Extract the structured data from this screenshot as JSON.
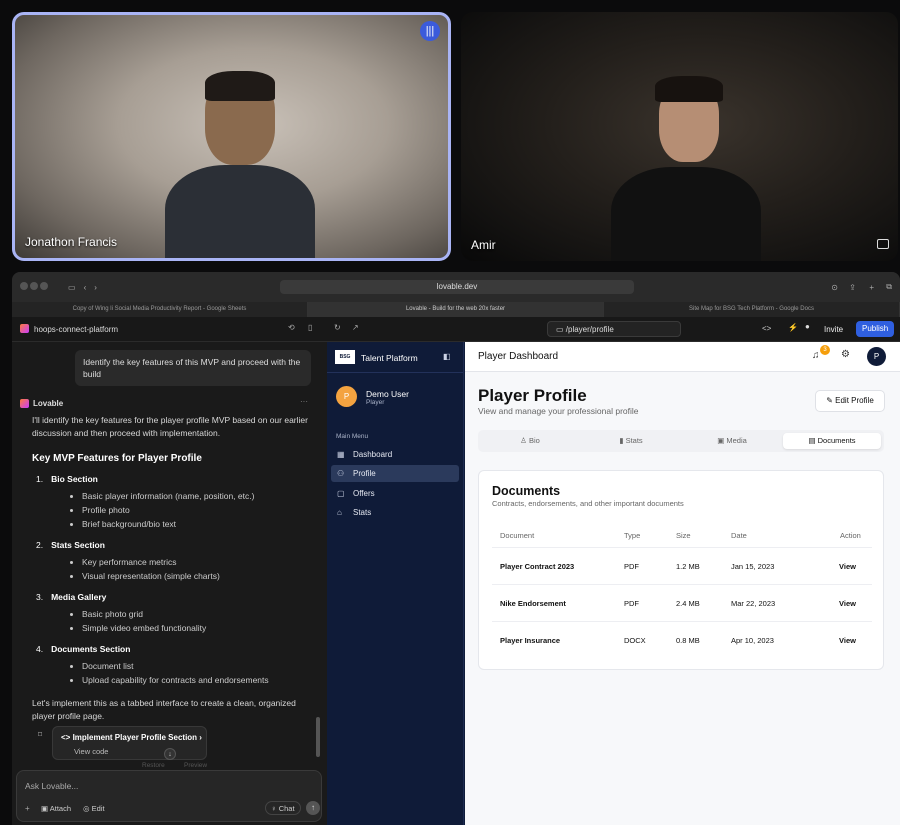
{
  "videos": {
    "left_name": "Jonathon Francis",
    "right_name": "Amir"
  },
  "browser": {
    "url": "lovable.dev",
    "tabs": [
      "Copy of Wing li Social Media Productivity Report - Google Sheets",
      "Lovable - Build for the web 20x faster",
      "Site Map for BSG Tech Platform - Google Docs"
    ]
  },
  "toolbar": {
    "project_name": "hoops-connect-platform",
    "route": "/player/profile",
    "invite": "Invite",
    "publish": "Publish"
  },
  "chat": {
    "user_message": "Identify the key features of this MVP and proceed with the build",
    "assistant_name": "Lovable",
    "intro": "I'll identify the key features for the player profile MVP based on our earlier discussion and then proceed with implementation.",
    "heading": "Key MVP Features for Player Profile",
    "sections": [
      {
        "num": "1.",
        "title": "Bio Section",
        "items": [
          "Basic player information (name, position, etc.)",
          "Profile photo",
          "Brief background/bio text"
        ]
      },
      {
        "num": "2.",
        "title": "Stats Section",
        "items": [
          "Key performance metrics",
          "Visual representation (simple charts)"
        ]
      },
      {
        "num": "3.",
        "title": "Media Gallery",
        "items": [
          "Basic photo grid",
          "Simple video embed functionality"
        ]
      },
      {
        "num": "4.",
        "title": "Documents Section",
        "items": [
          "Document list",
          "Upload capability for contracts and endorsements"
        ]
      }
    ],
    "outro": "Let's implement this as a tabbed interface to create a clean, organized player profile page.",
    "action_title": "Implement Player Profile Section",
    "action_link": "View code",
    "restore": "Restore",
    "preview": "Preview",
    "input_placeholder": "Ask Lovable...",
    "attach": "Attach",
    "edit": "Edit",
    "chat_btn": "Chat"
  },
  "sidebar": {
    "logo": "BSG",
    "title": "Talent Platform",
    "avatar_letter": "P",
    "user_name": "Demo User",
    "user_role": "Player",
    "menu_label": "Main Menu",
    "items": [
      "Dashboard",
      "Profile",
      "Offers",
      "Stats"
    ]
  },
  "app": {
    "header_title": "Player Dashboard",
    "notif_count": "3",
    "avatar_letter": "P",
    "page_title": "Player Profile",
    "page_subtitle": "View and manage your professional profile",
    "edit_profile": "Edit Profile",
    "tabs": [
      "Bio",
      "Stats",
      "Media",
      "Documents"
    ],
    "card_title": "Documents",
    "card_subtitle": "Contracts, endorsements, and other important documents",
    "columns": [
      "Document",
      "Type",
      "Size",
      "Date",
      "Action"
    ],
    "rows": [
      {
        "name": "Player Contract 2023",
        "type": "PDF",
        "size": "1.2 MB",
        "date": "Jan 15, 2023",
        "action": "View"
      },
      {
        "name": "Nike Endorsement",
        "type": "PDF",
        "size": "2.4 MB",
        "date": "Mar 22, 2023",
        "action": "View"
      },
      {
        "name": "Player Insurance",
        "type": "DOCX",
        "size": "0.8 MB",
        "date": "Apr 10, 2023",
        "action": "View"
      }
    ]
  }
}
